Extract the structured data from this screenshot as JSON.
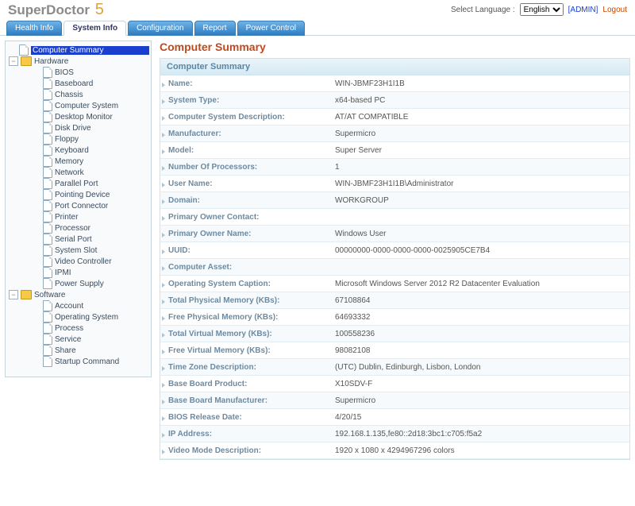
{
  "brand": {
    "name": "SuperDoctor",
    "suffix": "5"
  },
  "top": {
    "select_language": "Select Language :",
    "language_value": "English",
    "admin": "[ADMIN]",
    "logout": "Logout"
  },
  "tabs": [
    "Health Info",
    "System Info",
    "Configuration",
    "Report",
    "Power Control"
  ],
  "active_tab": 1,
  "tree": [
    {
      "lvl": 0,
      "t": "blank",
      "i": "page",
      "label": "Computer Summary",
      "sel": true
    },
    {
      "lvl": 0,
      "t": "minus",
      "i": "folder",
      "label": "Hardware"
    },
    {
      "lvl": 2,
      "t": "",
      "i": "page",
      "label": "BIOS"
    },
    {
      "lvl": 2,
      "t": "",
      "i": "page",
      "label": "Baseboard"
    },
    {
      "lvl": 2,
      "t": "",
      "i": "page",
      "label": "Chassis"
    },
    {
      "lvl": 2,
      "t": "",
      "i": "page",
      "label": "Computer System"
    },
    {
      "lvl": 2,
      "t": "",
      "i": "page",
      "label": "Desktop Monitor"
    },
    {
      "lvl": 2,
      "t": "",
      "i": "page",
      "label": "Disk Drive"
    },
    {
      "lvl": 2,
      "t": "",
      "i": "page",
      "label": "Floppy"
    },
    {
      "lvl": 2,
      "t": "",
      "i": "page",
      "label": "Keyboard"
    },
    {
      "lvl": 2,
      "t": "",
      "i": "page",
      "label": "Memory"
    },
    {
      "lvl": 2,
      "t": "",
      "i": "page",
      "label": "Network"
    },
    {
      "lvl": 2,
      "t": "",
      "i": "page",
      "label": "Parallel Port"
    },
    {
      "lvl": 2,
      "t": "",
      "i": "page",
      "label": "Pointing Device"
    },
    {
      "lvl": 2,
      "t": "",
      "i": "page",
      "label": "Port Connector"
    },
    {
      "lvl": 2,
      "t": "",
      "i": "page",
      "label": "Printer"
    },
    {
      "lvl": 2,
      "t": "",
      "i": "page",
      "label": "Processor"
    },
    {
      "lvl": 2,
      "t": "",
      "i": "page",
      "label": "Serial Port"
    },
    {
      "lvl": 2,
      "t": "",
      "i": "page",
      "label": "System Slot"
    },
    {
      "lvl": 2,
      "t": "",
      "i": "page",
      "label": "Video Controller"
    },
    {
      "lvl": 2,
      "t": "",
      "i": "page",
      "label": "IPMI"
    },
    {
      "lvl": 2,
      "t": "",
      "i": "page",
      "label": "Power Supply"
    },
    {
      "lvl": 0,
      "t": "minus",
      "i": "folder",
      "label": "Software"
    },
    {
      "lvl": 2,
      "t": "",
      "i": "page",
      "label": "Account"
    },
    {
      "lvl": 2,
      "t": "",
      "i": "page",
      "label": "Operating System"
    },
    {
      "lvl": 2,
      "t": "",
      "i": "page",
      "label": "Process"
    },
    {
      "lvl": 2,
      "t": "",
      "i": "page",
      "label": "Service"
    },
    {
      "lvl": 2,
      "t": "",
      "i": "page",
      "label": "Share"
    },
    {
      "lvl": 2,
      "t": "",
      "i": "page",
      "label": "Startup Command"
    }
  ],
  "page_title": "Computer Summary",
  "panel_title": "Computer Summary",
  "details": [
    {
      "k": "Name:",
      "v": "WIN-JBMF23H1I1B"
    },
    {
      "k": "System Type:",
      "v": "x64-based PC"
    },
    {
      "k": "Computer System Description:",
      "v": "AT/AT COMPATIBLE"
    },
    {
      "k": "Manufacturer:",
      "v": "Supermicro"
    },
    {
      "k": "Model:",
      "v": "Super Server"
    },
    {
      "k": "Number Of Processors:",
      "v": "1"
    },
    {
      "k": "User Name:",
      "v": "WIN-JBMF23H1I1B\\Administrator"
    },
    {
      "k": "Domain:",
      "v": "WORKGROUP"
    },
    {
      "k": "Primary Owner Contact:",
      "v": ""
    },
    {
      "k": "Primary Owner Name:",
      "v": "Windows User"
    },
    {
      "k": "UUID:",
      "v": "00000000-0000-0000-0000-0025905CE7B4"
    },
    {
      "k": "Computer Asset:",
      "v": ""
    },
    {
      "k": "Operating System Caption:",
      "v": "Microsoft Windows Server 2012 R2 Datacenter Evaluation"
    },
    {
      "k": "Total Physical Memory (KBs):",
      "v": "67108864"
    },
    {
      "k": "Free Physical Memory (KBs):",
      "v": "64693332"
    },
    {
      "k": "Total Virtual Memory (KBs):",
      "v": "100558236"
    },
    {
      "k": "Free Virtual Memory (KBs):",
      "v": "98082108"
    },
    {
      "k": "Time Zone Description:",
      "v": "(UTC) Dublin, Edinburgh, Lisbon, London"
    },
    {
      "k": "Base Board Product:",
      "v": "X10SDV-F"
    },
    {
      "k": "Base Board Manufacturer:",
      "v": "Supermicro"
    },
    {
      "k": "BIOS Release Date:",
      "v": "4/20/15"
    },
    {
      "k": "IP Address:",
      "v": "192.168.1.135,fe80::2d18:3bc1:c705:f5a2"
    },
    {
      "k": "Video Mode Description:",
      "v": "1920 x 1080 x 4294967296 colors"
    }
  ]
}
